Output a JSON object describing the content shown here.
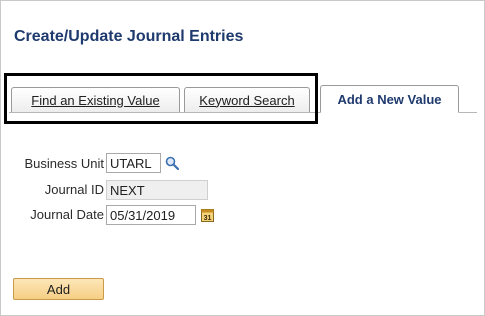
{
  "page": {
    "title": "Create/Update Journal Entries"
  },
  "tabs": [
    {
      "label": "Find an Existing Value",
      "active": false
    },
    {
      "label": "Keyword Search",
      "active": false
    },
    {
      "label": "Add a New Value",
      "active": true
    }
  ],
  "form": {
    "business_unit": {
      "label": "Business Unit",
      "value": "UTARL",
      "icon": "search-icon"
    },
    "journal_id": {
      "label": "Journal ID",
      "value": "NEXT"
    },
    "journal_date": {
      "label": "Journal Date",
      "value": "05/31/2019",
      "icon": "calendar-icon"
    }
  },
  "actions": {
    "add_label": "Add"
  },
  "colors": {
    "title": "#1f3a6e",
    "add_button": "#f6cf85",
    "highlight_border": "#000000"
  }
}
